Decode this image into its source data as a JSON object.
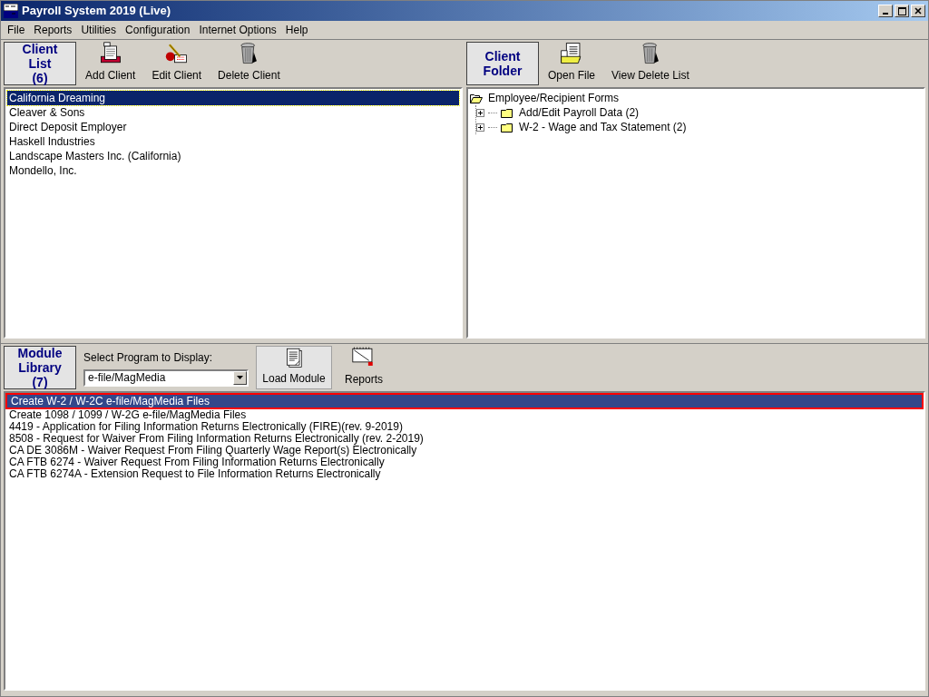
{
  "window": {
    "title": "Payroll System 2019 (Live)"
  },
  "menu": [
    "File",
    "Reports",
    "Utilities",
    "Configuration",
    "Internet Options",
    "Help"
  ],
  "client_pane": {
    "title_lines": [
      "Client",
      "List",
      "(6)"
    ],
    "tools": [
      {
        "kind": "add",
        "label": "Add Client"
      },
      {
        "kind": "edit",
        "label": "Edit Client"
      },
      {
        "kind": "trash",
        "label": "Delete Client"
      }
    ],
    "clients": [
      {
        "label": "California Dreaming",
        "selected": true
      },
      {
        "label": "Cleaver & Sons",
        "selected": false
      },
      {
        "label": "Direct Deposit Employer",
        "selected": false
      },
      {
        "label": "Haskell Industries",
        "selected": false
      },
      {
        "label": "Landscape Masters Inc. (California)",
        "selected": false
      },
      {
        "label": "Mondello, Inc.",
        "selected": false
      }
    ]
  },
  "folder_pane": {
    "title_lines": [
      "Client",
      "Folder"
    ],
    "tools": [
      {
        "kind": "open",
        "label": "Open File"
      },
      {
        "kind": "trash",
        "label": "View Delete List"
      }
    ],
    "tree": [
      {
        "label": "Employee/Recipient Forms",
        "expanded": true,
        "children": [
          {
            "label": "Add/Edit Payroll Data  (2)",
            "expanded": false
          },
          {
            "label": "W-2 - Wage and Tax Statement  (2)",
            "expanded": false
          }
        ]
      }
    ]
  },
  "module_pane": {
    "title_lines": [
      "Module",
      "Library",
      "(7)"
    ],
    "program_select": {
      "label": "Select Program to Display:",
      "value": "e-file/MagMedia"
    },
    "tools": [
      {
        "kind": "load",
        "label": "Load Module",
        "pressed": true
      },
      {
        "kind": "reports",
        "label": "Reports",
        "pressed": false
      }
    ],
    "modules": [
      {
        "label": "Create W-2 / W-2C e-file/MagMedia Files",
        "selected": true
      },
      {
        "label": "Create 1098 / 1099 / W-2G e-file/MagMedia Files",
        "selected": false
      },
      {
        "label": "4419 - Application for Filing Information Returns Electronically (FIRE)(rev. 9-2019)",
        "selected": false
      },
      {
        "label": "8508 - Request for Waiver From Filing Information Returns Electronically (rev. 2-2019)",
        "selected": false
      },
      {
        "label": "CA DE 3086M - Waiver Request From Filing Quarterly Wage Report(s) Electronically",
        "selected": false
      },
      {
        "label": "CA FTB 6274 - Waiver Request From Filing Information Returns Electronically",
        "selected": false
      },
      {
        "label": "CA FTB 6274A - Extension Request to File Information Returns Electronically",
        "selected": false
      }
    ]
  }
}
